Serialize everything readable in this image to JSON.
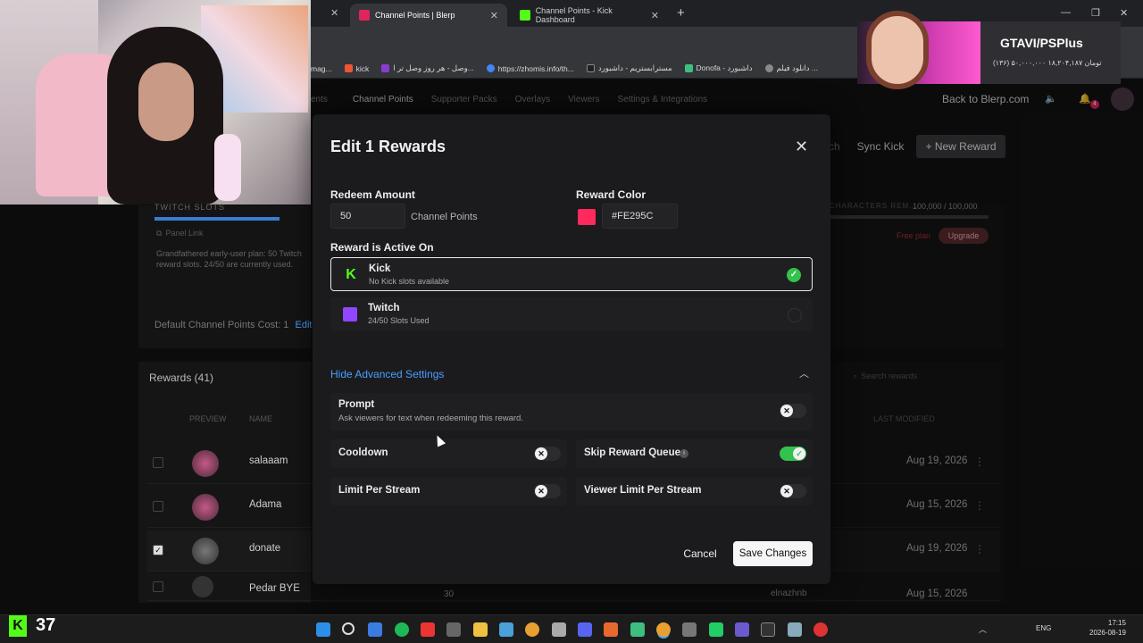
{
  "browser": {
    "tabs": [
      {
        "label": "Channel Points | Blerp",
        "color": "#e0245e"
      },
      {
        "label": "Channel Points - Kick Dashboard",
        "color": "#53fc18"
      }
    ],
    "bookmarks": [
      "mag...",
      "kick",
      "وصل - هر روز وصل تر ا...",
      "https://zhomis.info/th...",
      "مسترابستریم - داشبورد",
      "Donofa - داشبورد",
      "دانلود فیلم ...",
      "..."
    ]
  },
  "ad": {
    "title": "GTAVI/PSPlus",
    "subtitle": "(۱۳۶) ۵۰,۰۰۰,۰۰۰ تومان ۱۸,۲۰۴,۱۸۷"
  },
  "nav": {
    "items": [
      "ents",
      "Channel Points",
      "Supporter Packs",
      "Overlays",
      "Viewers",
      "Settings & Integrations"
    ],
    "back_link": "Back to Blerp.com",
    "notif_count": "4"
  },
  "background": {
    "sync_label": "Sync Kick",
    "new_reward_label": "+ New Reward",
    "partial_label": "ch",
    "twitch_slots": "TWITCH SLOTS",
    "panel_link": "Panel Link",
    "grandfathered": "Grandfathered early-user plan: 50 Twitch reward slots. 24/50 are currently used.",
    "chars_label": "CHARACTERS REM...",
    "chars_value": "100,000 / 100,000",
    "free_plan": "Free plan",
    "upgrade": "Upgrade",
    "default_cost": "Default Channel Points Cost: 1",
    "edit": "Edit",
    "rewards_header": "Rewards (41)",
    "search_placeholder": "Search rewards",
    "col_preview": "PREVIEW",
    "col_name": "NAME",
    "col_modified": "LAST MODIFIED",
    "rows": [
      {
        "name": "salaaam",
        "date": "Aug 19, 2026"
      },
      {
        "name": "Adama",
        "date": "Aug 15, 2026"
      },
      {
        "name": "donate",
        "date": "Aug 19, 2026"
      },
      {
        "name": "Pedar BYE",
        "date": "Aug 15, 2026",
        "cost": "30",
        "user": "elnazhnb"
      }
    ]
  },
  "modal": {
    "title": "Edit 1 Rewards",
    "redeem_label": "Redeem Amount",
    "redeem_value": "50",
    "redeem_unit": "Channel Points",
    "color_label": "Reward Color",
    "color_value": "#FE295C",
    "swatch_color": "#FE295C",
    "active_on_label": "Reward is Active On",
    "platforms": [
      {
        "name": "Kick",
        "status": "No Kick slots available",
        "selected": true
      },
      {
        "name": "Twitch",
        "status": "24/50 Slots Used",
        "selected": false
      }
    ],
    "advanced_toggle": "Hide Advanced Settings",
    "prompt": {
      "label": "Prompt",
      "desc": "Ask viewers for text when redeeming this reward.",
      "on": false
    },
    "settings": [
      {
        "label": "Cooldown",
        "on": false
      },
      {
        "label": "Skip Reward Queue",
        "on": true
      },
      {
        "label": "Limit Per Stream",
        "on": false
      },
      {
        "label": "Viewer Limit Per Stream",
        "on": false
      }
    ],
    "cancel_label": "Cancel",
    "save_label": "Save Changes"
  },
  "taskbar": {
    "kick_count": "37",
    "lang": "ENG",
    "time": "17:15",
    "date": "2026-08-19"
  },
  "colors": {
    "accent": "#53fc18",
    "toggle_on": "#33c24d",
    "link": "#4a9eff",
    "twitch": "#9146ff"
  }
}
